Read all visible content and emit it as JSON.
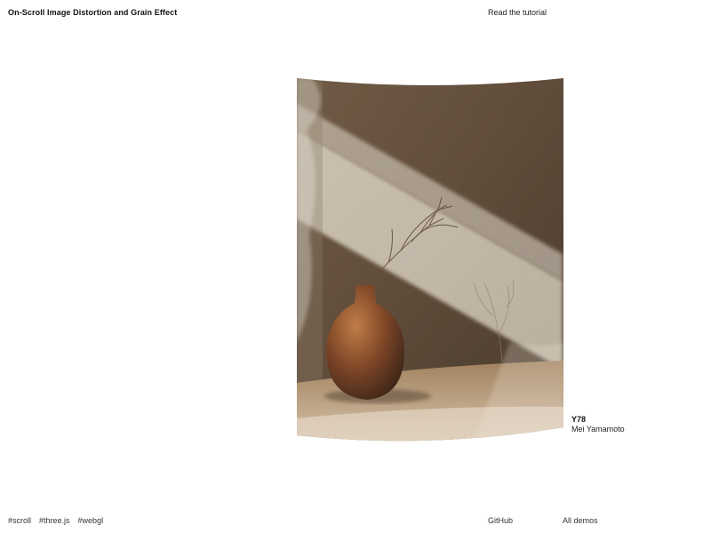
{
  "header": {
    "title": "On-Scroll Image Distortion and Grain Effect",
    "tutorial_label": "Read the tutorial"
  },
  "figure": {
    "code": "Y78",
    "author": "Mei Yamamoto"
  },
  "footer": {
    "tags": [
      "#scroll",
      "#three.js",
      "#webgl"
    ],
    "github_label": "GitHub",
    "demos_label": "All demos"
  }
}
